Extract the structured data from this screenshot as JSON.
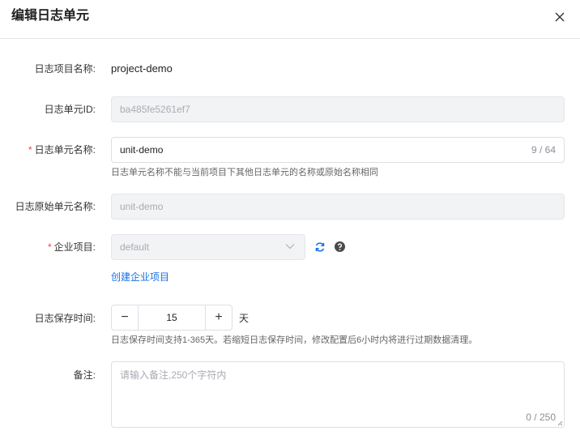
{
  "dialog": {
    "title": "编辑日志单元"
  },
  "fields": {
    "project_name": {
      "label": "日志项目名称:",
      "value": "project-demo"
    },
    "unit_id": {
      "label": "日志单元ID:",
      "value": "ba485fe5261ef7"
    },
    "unit_name": {
      "required": "*",
      "label": "日志单元名称:",
      "value": "unit-demo",
      "counter": "9 / 64",
      "hint": "日志单元名称不能与当前项目下其他日志单元的名称或原始名称相同"
    },
    "original_name": {
      "label": "日志原始单元名称:",
      "placeholder": "unit-demo"
    },
    "enterprise_project": {
      "required": "*",
      "label": "企业项目:",
      "value": "default",
      "create_link": "创建企业项目"
    },
    "retention": {
      "label": "日志保存时间:",
      "minus": "−",
      "value": "15",
      "plus": "+",
      "unit": "天",
      "hint": "日志保存时间支持1-365天。若缩短日志保存时间，修改配置后6小时内将进行过期数据清理。"
    },
    "remark": {
      "label": "备注:",
      "placeholder": "请输入备注,250个字符内",
      "counter": "0 / 250"
    }
  },
  "icons": {
    "close": "close-icon",
    "dropdown": "chevron-down-icon",
    "refresh": "refresh-icon",
    "help": "help-icon"
  },
  "colors": {
    "required": "#e5484d",
    "link": "#1a6fe8",
    "refresh": "#1a6fe8",
    "help": "#4a4a4a"
  }
}
